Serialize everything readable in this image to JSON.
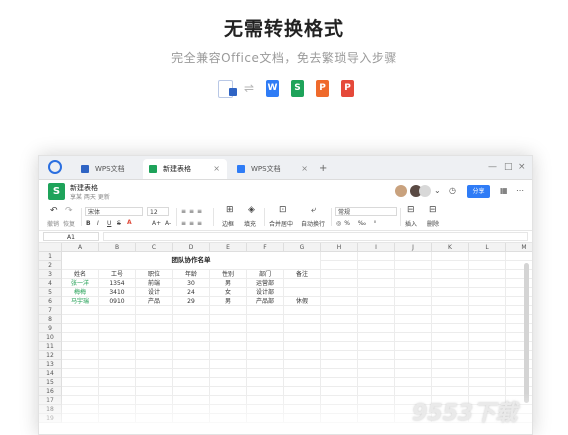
{
  "hero": {
    "title": "无需转换格式",
    "subtitle": "完全兼容Office文档，免去繁琐导入步骤",
    "arrows": "⇌",
    "formats": [
      {
        "name": "word-doc-icon",
        "letter": "",
        "color": "#2f64c4"
      },
      {
        "name": "wps-writer-icon",
        "letter": "W",
        "color": "#2f7cf6"
      },
      {
        "name": "wps-sheet-icon",
        "letter": "S",
        "color": "#1ea35a"
      },
      {
        "name": "wps-slides-icon",
        "letter": "P",
        "color": "#ef6a2b"
      },
      {
        "name": "wps-pdf-icon",
        "letter": "P",
        "color": "#e5493a"
      }
    ]
  },
  "tabs": [
    {
      "label": "WPS文档",
      "icon_color": "#2f64c4",
      "active": false
    },
    {
      "label": "新建表格",
      "icon_color": "#1ea35a",
      "active": true
    },
    {
      "label": "WPS文档",
      "icon_color": "#2f7cf6",
      "active": false
    }
  ],
  "tab_close": "×",
  "tab_add": "+",
  "window_controls": {
    "minimize": "—",
    "maximize": "□",
    "close": "×"
  },
  "doc": {
    "badge": "S",
    "name": "新建表格",
    "meta": "享某 两天 更新",
    "share_label": "分享"
  },
  "toolbar": {
    "undo": "↶",
    "redo": "↷",
    "undo_label": "撤销",
    "redo_label": "恢复",
    "font": "宋体",
    "font_size": "12",
    "bold": "B",
    "italic": "I",
    "underline": "U",
    "strike": "S",
    "grow": "A+",
    "shrink": "A-",
    "border_label": "边框",
    "fill_label": "填充",
    "merge_label": "合并居中",
    "wrap_label": "自动换行",
    "format": "常规",
    "insert_label": "插入",
    "delete_label": "删除"
  },
  "formula": {
    "namebox": "A1",
    "value": ""
  },
  "columns": [
    "A",
    "B",
    "C",
    "D",
    "E",
    "F",
    "G",
    "H",
    "I",
    "J",
    "K",
    "L",
    "M",
    "N"
  ],
  "rows": [
    "1",
    "2",
    "3",
    "4",
    "5",
    "6",
    "7",
    "8",
    "9",
    "10",
    "11",
    "12",
    "13",
    "14",
    "15",
    "16",
    "17",
    "18",
    "19"
  ],
  "sheet": {
    "title": "团队协作名单",
    "headers": [
      "姓名",
      "工号",
      "职位",
      "年龄",
      "性别",
      "部门",
      "备注"
    ],
    "records": [
      [
        "张一洋",
        "1354",
        "前端",
        "30",
        "男",
        "运营部",
        ""
      ],
      [
        "梅梅",
        "3410",
        "设计",
        "24",
        "女",
        "设计部",
        ""
      ],
      [
        "马宇瑞",
        "0910",
        "产品",
        "29",
        "男",
        "产品部",
        "休假"
      ]
    ]
  },
  "watermark": "9553下载"
}
